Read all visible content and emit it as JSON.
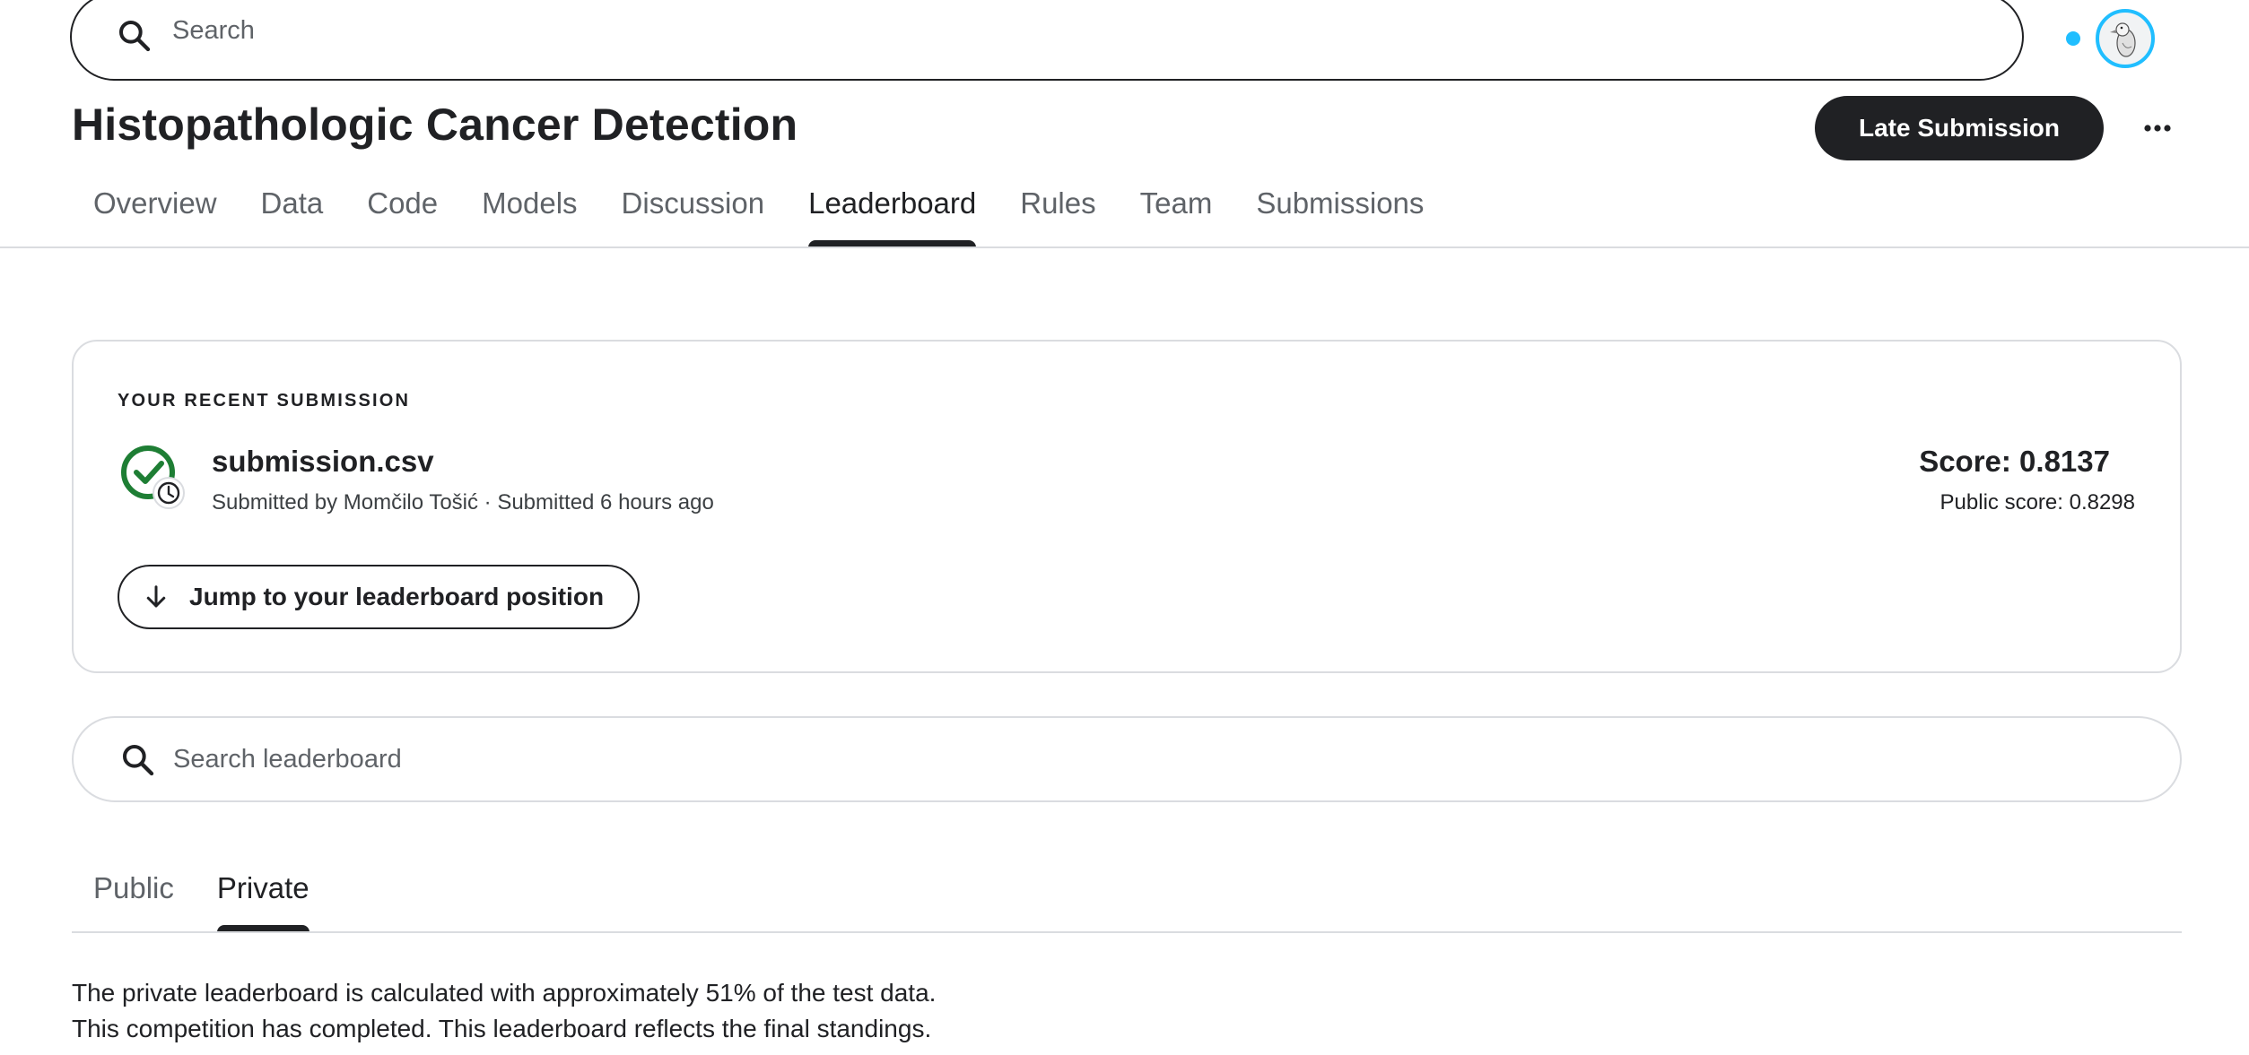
{
  "search": {
    "placeholder": "Search"
  },
  "header": {
    "title": "Histopathologic Cancer Detection",
    "late_submission_label": "Late Submission",
    "more_label": "⋯"
  },
  "tabs": [
    {
      "label": "Overview"
    },
    {
      "label": "Data"
    },
    {
      "label": "Code"
    },
    {
      "label": "Models"
    },
    {
      "label": "Discussion"
    },
    {
      "label": "Leaderboard",
      "active": true
    },
    {
      "label": "Rules"
    },
    {
      "label": "Team"
    },
    {
      "label": "Submissions"
    }
  ],
  "recent_submission": {
    "heading": "YOUR RECENT SUBMISSION",
    "file_name": "submission.csv",
    "meta": "Submitted by Momčilo Tošić · Submitted 6 hours ago",
    "score": "Score: 0.8137",
    "public_score": "Public score: 0.8298",
    "jump_label": "Jump to your leaderboard position",
    "status_icon": "success-pending-icon"
  },
  "leaderboard_search": {
    "placeholder": "Search leaderboard"
  },
  "leaderboard_tabs": [
    {
      "label": "Public"
    },
    {
      "label": "Private",
      "active": true
    }
  ],
  "info": {
    "line1": "The private leaderboard is calculated with approximately 51% of the test data.",
    "line2": "This competition has completed. This leaderboard reflects the final standings."
  },
  "colors": {
    "accent": "#20beff",
    "dark": "#202124",
    "success": "#1e7e34",
    "border": "#dadce0"
  }
}
